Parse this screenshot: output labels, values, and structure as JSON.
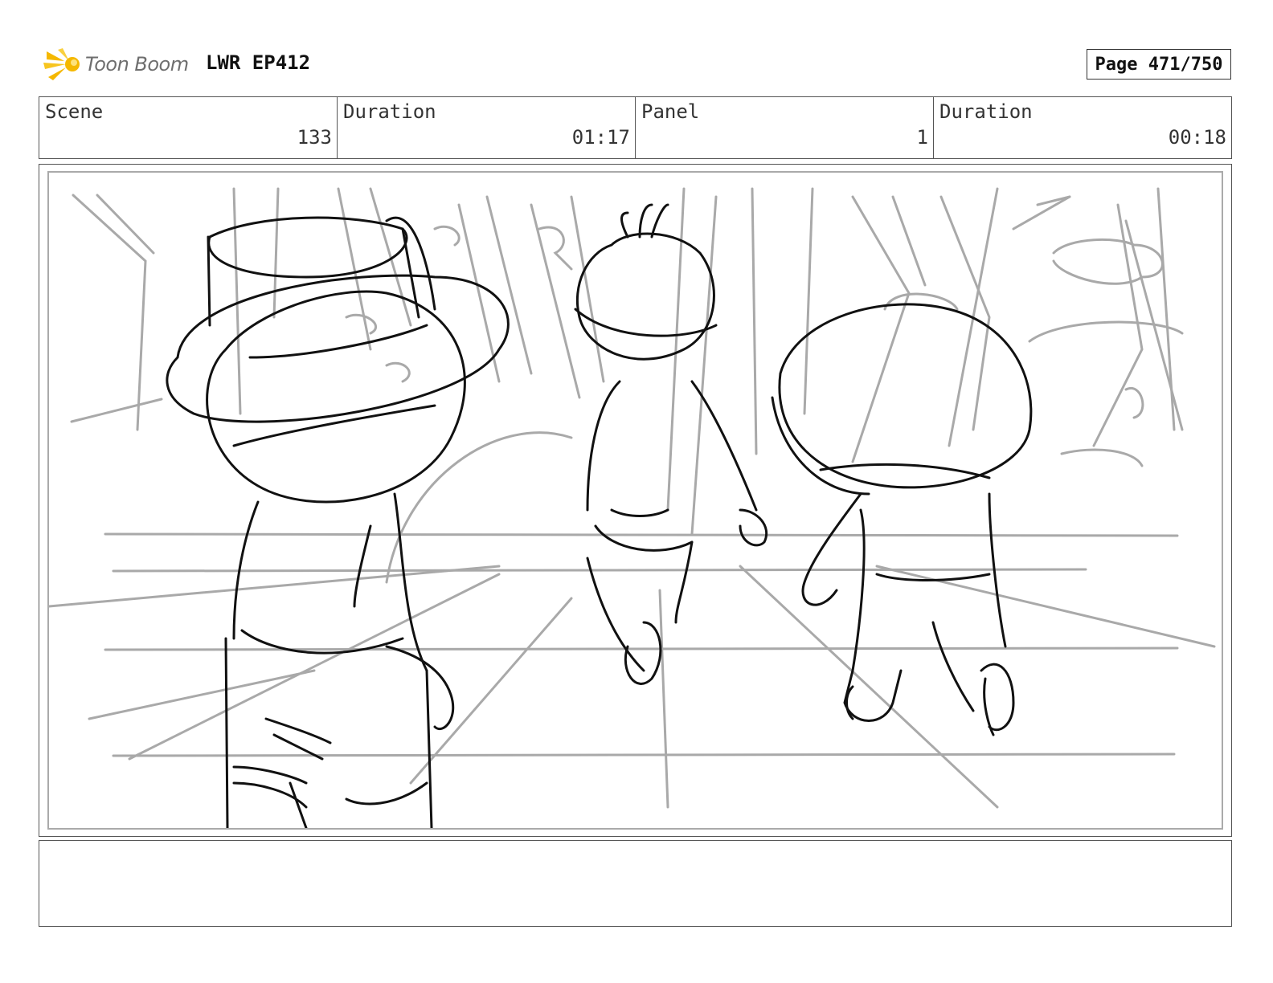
{
  "header": {
    "logo_text": "Toon Boom",
    "project": "LWR EP412",
    "page": "Page 471/750"
  },
  "info": {
    "scene_label": "Scene",
    "scene_value": "133",
    "scene_duration_label": "Duration",
    "scene_duration_value": "01:17",
    "panel_label": "Panel",
    "panel_value": "1",
    "panel_duration_label": "Duration",
    "panel_duration_value": "00:18"
  },
  "notes": {
    "text": ""
  }
}
